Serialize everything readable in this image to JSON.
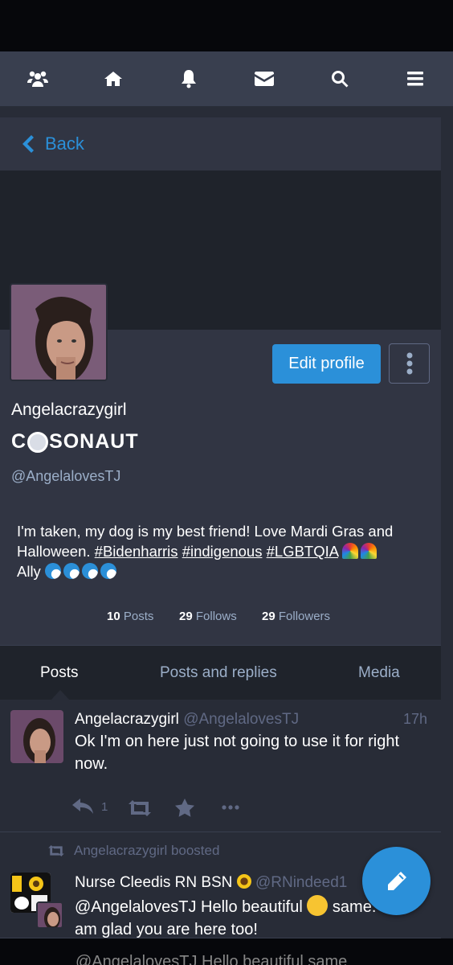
{
  "nav": {
    "icons": [
      "people-icon",
      "home-icon",
      "bell-icon",
      "envelope-icon",
      "search-icon",
      "menu-icon"
    ]
  },
  "back": {
    "label": "Back"
  },
  "profile": {
    "edit_label": "Edit profile",
    "display_name": "Angelacrazygirl",
    "badge_left": "C",
    "badge_right": "SONAUT",
    "handle": "@AngelalovesTJ",
    "bio_line1": "I'm taken, my dog is my best friend! Love Mardi Gras and",
    "bio_line2_text": "Halloween. ",
    "tags": [
      "#Bidenharris",
      "#indigenous",
      "#LGBTQIA"
    ],
    "bio_line3": "Ally",
    "counts": {
      "posts_num": "10",
      "posts_label": "Posts",
      "follows_num": "29",
      "follows_label": "Follows",
      "followers_num": "29",
      "followers_label": "Followers"
    }
  },
  "tabs": [
    "Posts",
    "Posts and replies",
    "Media"
  ],
  "statuses": [
    {
      "name": "Angelacrazygirl",
      "handle": "@AngelalovesTJ",
      "time": "17h",
      "text": "Ok I'm on here just not going to use it for right now.",
      "reply_count": "1"
    },
    {
      "boosted_by": "Angelacrazygirl boosted",
      "name": "Nurse Cleedis RN BSN",
      "handle": "@RNindeed1",
      "text_part1": "@AngelalovesTJ Hello beautiful",
      "text_part2": "same. I",
      "text_line2": "am glad you are here too!"
    }
  ],
  "bottom_strip": {
    "text": "@AngelalovesTJ Hello beautiful  same"
  },
  "colors": {
    "accent": "#2b90d9",
    "bg": "#282c37",
    "muted": "#606984",
    "secondary": "#9baec8"
  }
}
